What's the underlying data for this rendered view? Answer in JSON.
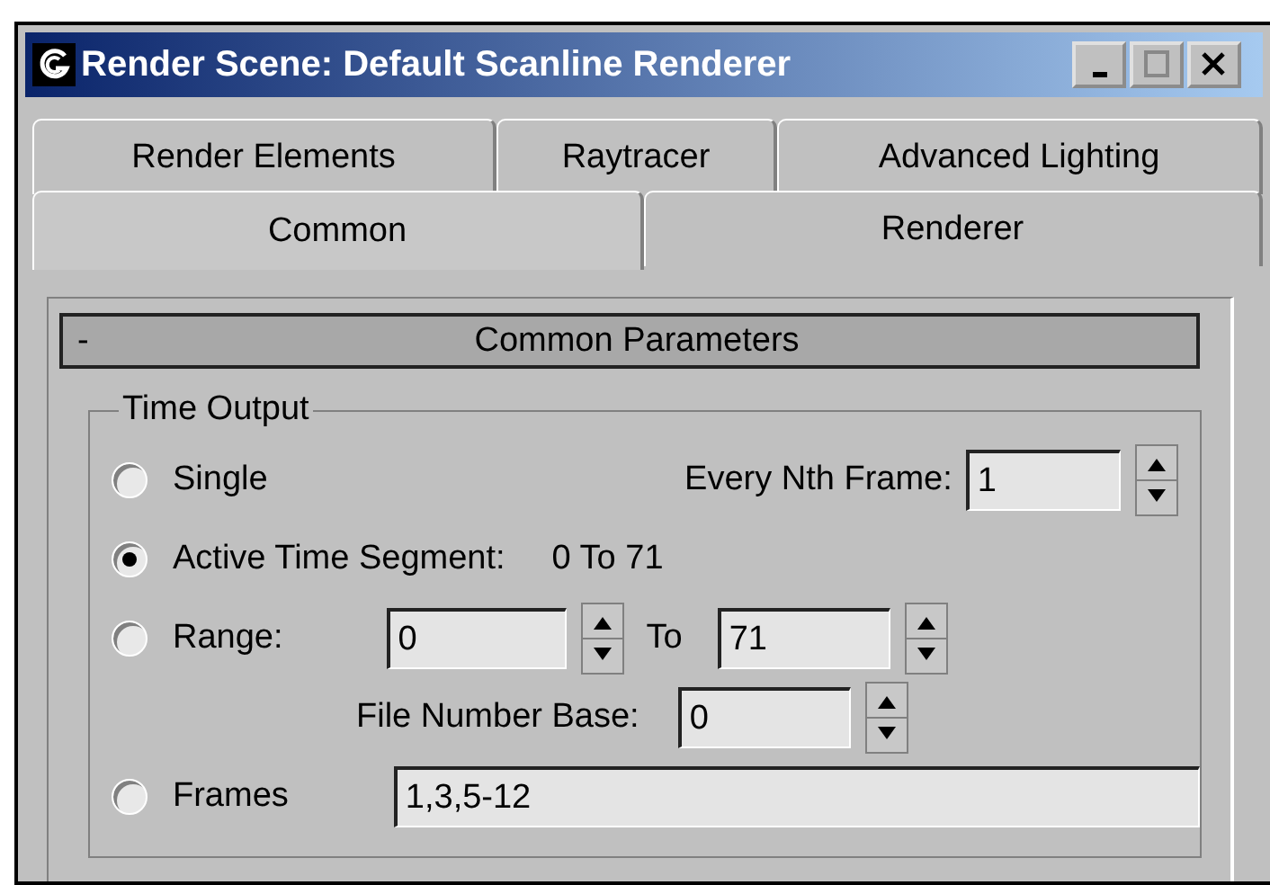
{
  "window": {
    "title": "Render Scene: Default Scanline Renderer"
  },
  "tab_rows": [
    [
      {
        "label": "Render Elements",
        "selected": false
      },
      {
        "label": "Raytracer",
        "selected": false
      },
      {
        "label": "Advanced Lighting",
        "selected": false
      }
    ],
    [
      {
        "label": "Common",
        "selected": true
      },
      {
        "label": "Renderer",
        "selected": false
      }
    ]
  ],
  "rollout": {
    "toggle": "-",
    "title": "Common Parameters"
  },
  "time_output": {
    "title": "Time Output",
    "options": [
      {
        "label": "Single",
        "selected": false
      },
      {
        "label": "Active Time Segment:",
        "selected": true
      },
      {
        "label": "Range:",
        "selected": false
      },
      {
        "label": "Frames",
        "selected": false
      }
    ],
    "every_nth_frame": {
      "label": "Every Nth Frame:",
      "value": "1"
    },
    "active_segment": "0 To 71",
    "range": {
      "from": "0",
      "to_label": "To",
      "to": "71"
    },
    "file_number_base": {
      "label": "File Number Base:",
      "value": "0"
    },
    "frames": "1,3,5-12"
  }
}
